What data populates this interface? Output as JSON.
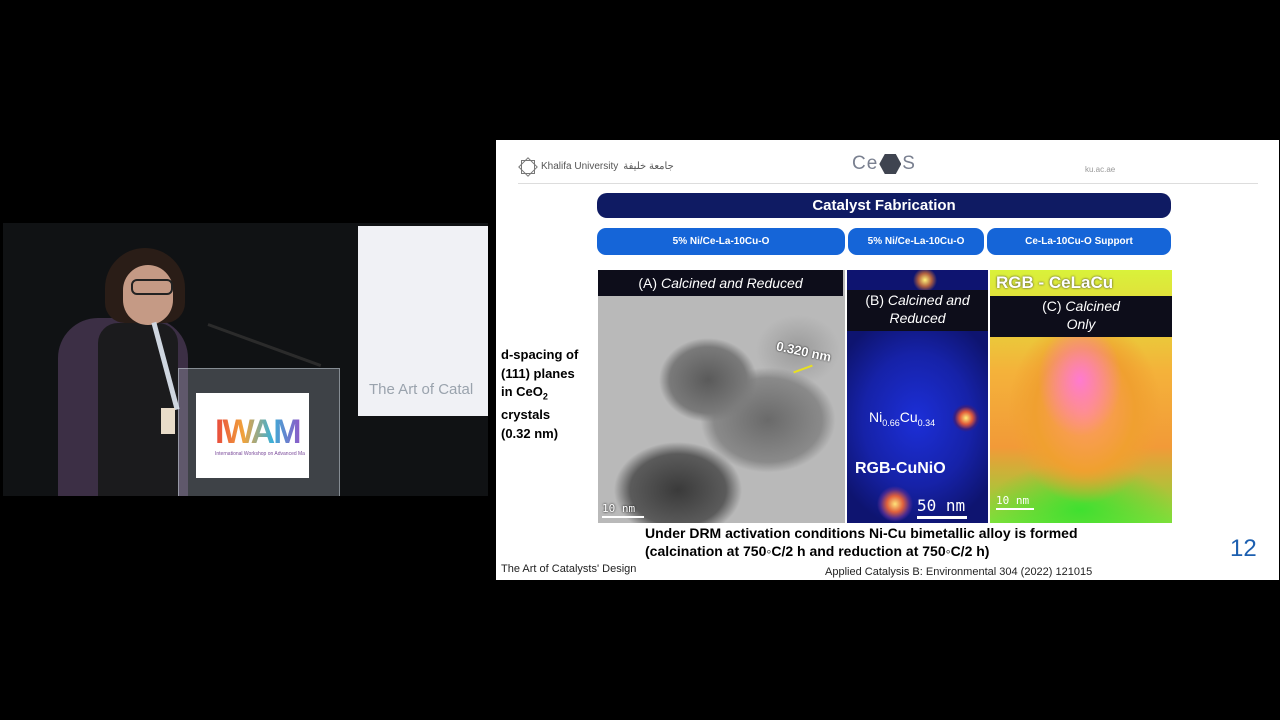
{
  "camera": {
    "projector_text": "The Art of Catal",
    "podium_logo": "IWAM",
    "podium_subtitle": "International Workshop on Advanced Materials"
  },
  "slide": {
    "header": {
      "university": "Khalifa University",
      "university_arabic": "جامعة خليفة",
      "center_logo": {
        "prefix": "Ce",
        "suffix": "S",
        "hex_letters": "CA"
      },
      "url": "ku.ac.ae"
    },
    "banner": "Catalyst Fabrication",
    "pills": [
      "5% Ni/Ce-La-10Cu-O",
      "5% Ni/Ce-La-10Cu-O",
      "Ce-La-10Cu-O Support"
    ],
    "side_note": {
      "line1": "d-spacing of",
      "line2": "(111) planes",
      "line3_prefix": "in CeO",
      "line3_sub": "2",
      "line4": "crystals",
      "line5": "(0.32 nm)"
    },
    "panels": {
      "a": {
        "label_prefix": "(A) ",
        "label_italic": "Calcined and Reduced",
        "dspacing": "0.320 nm",
        "scale": "10 nm"
      },
      "b": {
        "label_line1_prefix": "(B) ",
        "label_line1_italic": "Calcined and",
        "label_line2": "Reduced",
        "formula_ni": "Ni",
        "formula_ni_sub": "0.66",
        "formula_cu": "Cu",
        "formula_cu_sub": "0.34",
        "rgb": "RGB-CuNiO",
        "scale": "50 nm"
      },
      "c": {
        "rgb": "RGB - CeLaCu",
        "label_line1_prefix": "(C) ",
        "label_line1_italic": "Calcined",
        "label_line2": "Only",
        "scale": "10 nm"
      }
    },
    "caption_line1": "Under DRM activation conditions Ni-Cu bimetallic alloy is formed",
    "caption_line2": "(calcination at 750◦C/2 h and reduction at 750◦C/2 h)",
    "slide_number": "12",
    "footer_left": "The Art of Catalysts' Design",
    "footer_reference": "Applied Catalysis B: Environmental 304 (2022) 121015"
  }
}
